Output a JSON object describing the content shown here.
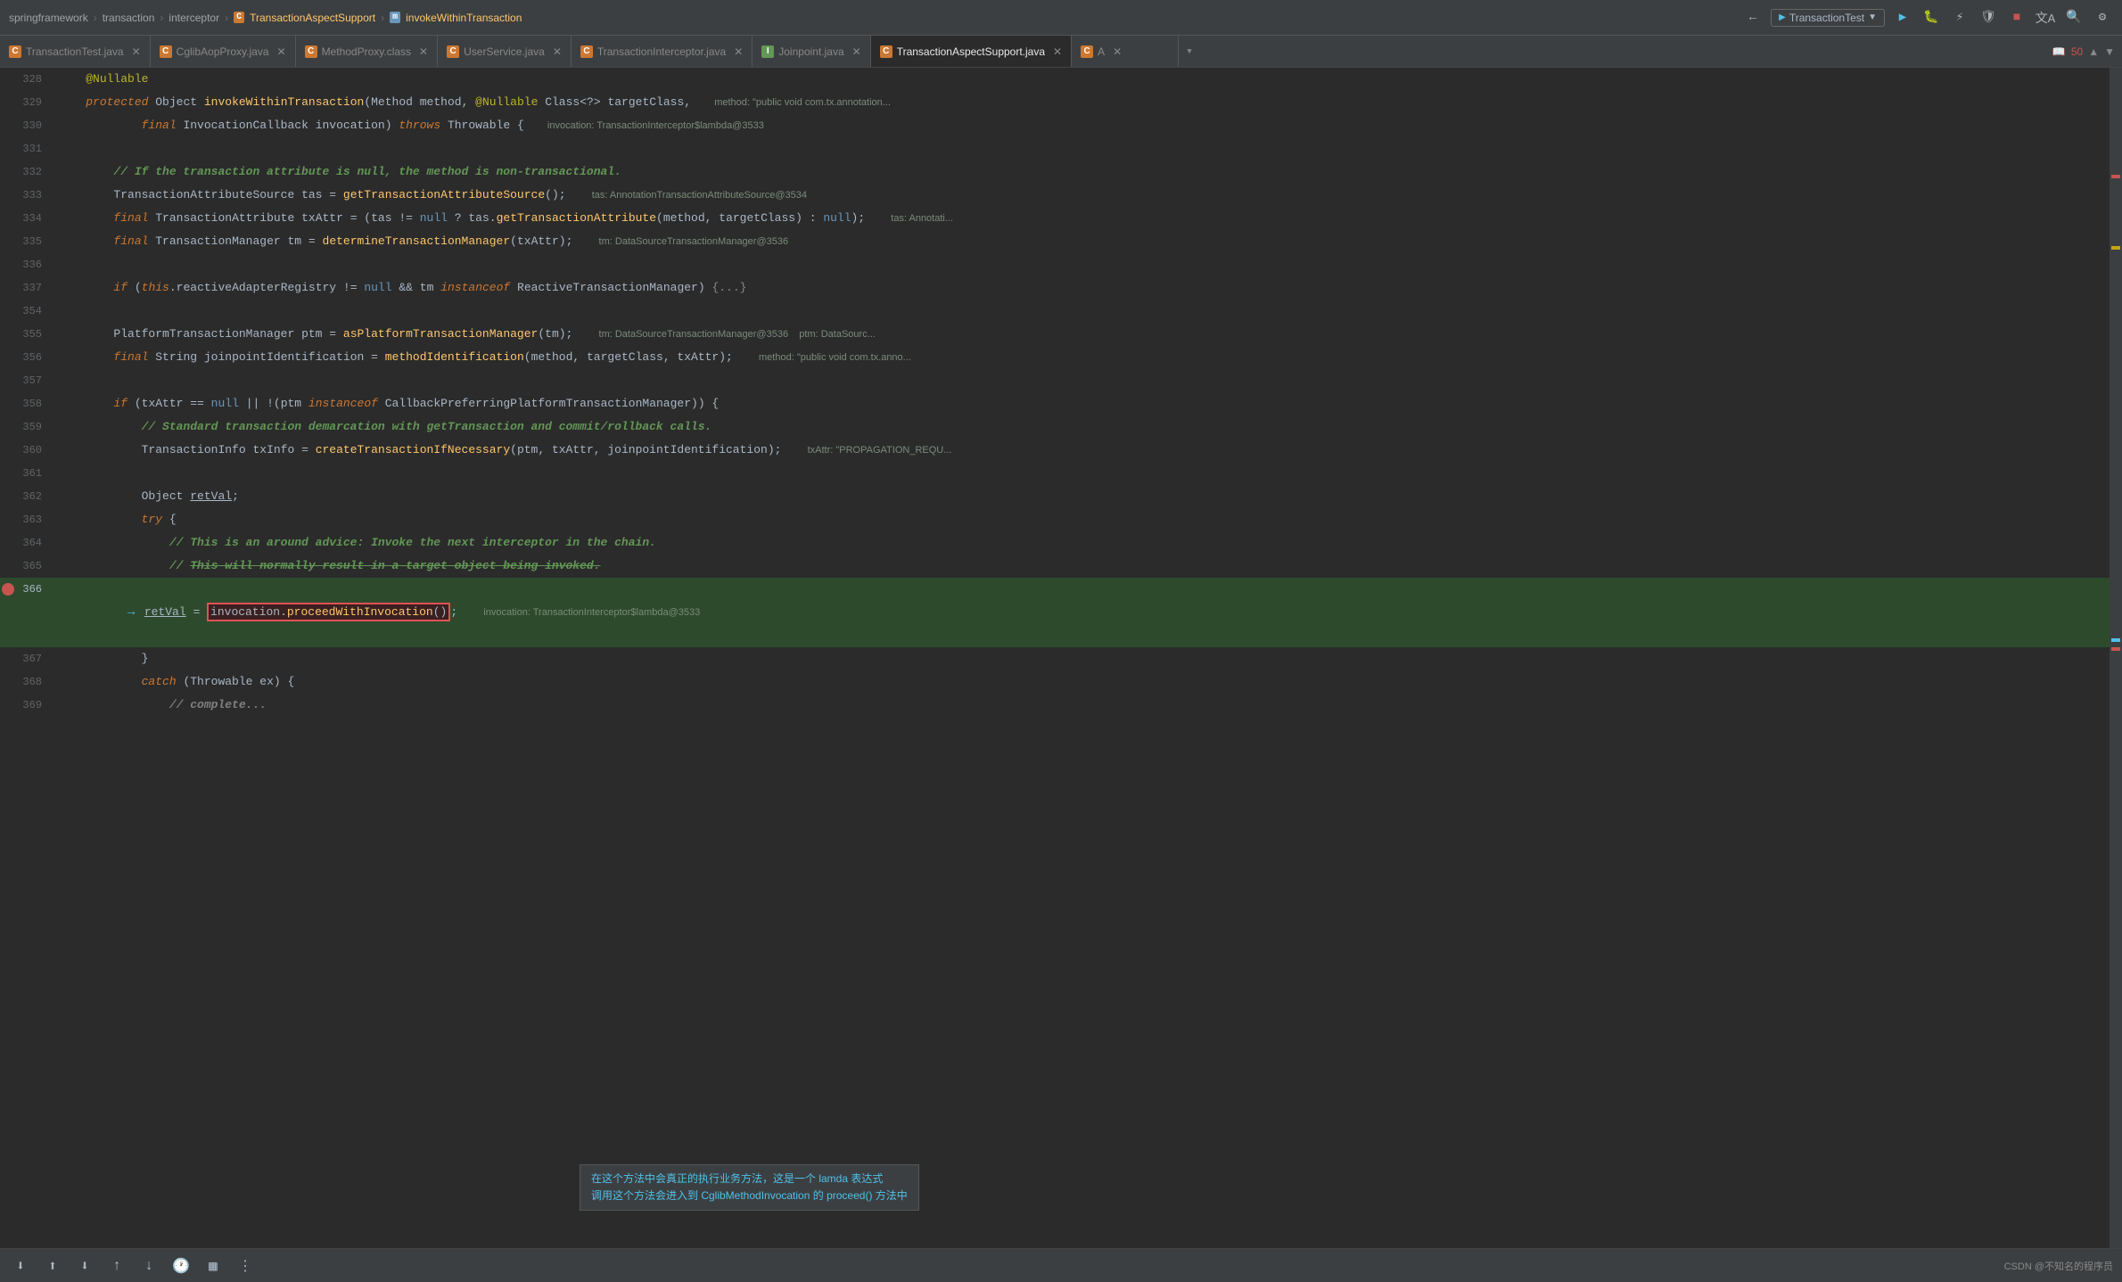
{
  "topbar": {
    "breadcrumbs": [
      {
        "label": "springframework",
        "type": "text"
      },
      {
        "label": "›",
        "type": "sep"
      },
      {
        "label": "transaction",
        "type": "text"
      },
      {
        "label": "›",
        "type": "sep"
      },
      {
        "label": "interceptor",
        "type": "text"
      },
      {
        "label": "›",
        "type": "sep"
      },
      {
        "label": "C TransactionAspectSupport",
        "type": "class"
      },
      {
        "label": "›",
        "type": "sep"
      },
      {
        "label": "m invokeWithinTransaction",
        "type": "method"
      }
    ],
    "run_config": "TransactionTest",
    "search_icon": "🔍",
    "settings_icon": "⚙"
  },
  "tabs": [
    {
      "label": "TransactionTest.java",
      "icon": "C",
      "type": "c",
      "active": false
    },
    {
      "label": "CglibAopProxy.java",
      "icon": "C",
      "type": "c",
      "active": false
    },
    {
      "label": "MethodProxy.class",
      "icon": "C",
      "type": "c",
      "active": false
    },
    {
      "label": "UserService.java",
      "icon": "C",
      "type": "c",
      "active": false
    },
    {
      "label": "TransactionInterceptor.java",
      "icon": "C",
      "type": "c",
      "active": false
    },
    {
      "label": "Joinpoint.java",
      "icon": "I",
      "type": "i",
      "active": false
    },
    {
      "label": "TransactionAspectSupport.java",
      "icon": "C",
      "type": "c",
      "active": true
    },
    {
      "label": "A",
      "icon": "C",
      "type": "c",
      "active": false
    }
  ],
  "lines": [
    {
      "num": 328,
      "content": "    @Nullable",
      "type": "annotation"
    },
    {
      "num": 329,
      "content": "    protected Object invokeWithinTransaction(Method method, @Nullable Class<?> targetClass,",
      "debug": "method: \"public void com.tx.annotation..."
    },
    {
      "num": 330,
      "content": "            final InvocationCallback invocation) throws Throwable {",
      "debug": "invocation: TransactionInterceptor$lambda@3533"
    },
    {
      "num": 331,
      "content": ""
    },
    {
      "num": 332,
      "content": "        // If the transaction attribute is null, the method is non-transactional.",
      "type": "comment-bold"
    },
    {
      "num": 333,
      "content": "        TransactionAttributeSource tas = getTransactionAttributeSource();",
      "debug": "tas: AnnotationTransactionAttributeSource@3534"
    },
    {
      "num": 334,
      "content": "        final TransactionAttribute txAttr = (tas != null ? tas.getTransactionAttribute(method, targetClass) : null);",
      "debug": "tas: Annotati..."
    },
    {
      "num": 335,
      "content": "        final TransactionManager tm = determineTransactionManager(txAttr);",
      "debug": "tm: DataSourceTransactionManager@3536"
    },
    {
      "num": 336,
      "content": ""
    },
    {
      "num": 337,
      "content": "        if (this.reactiveAdapterRegistry != null && tm instanceof ReactiveTransactionManager) {...}",
      "type": "collapsed"
    },
    {
      "num": 354,
      "content": ""
    },
    {
      "num": 355,
      "content": "        PlatformTransactionManager ptm = asPlatformTransactionManager(tm);",
      "debug": "tm: DataSourceTransactionManager@3536    ptm: DataSourc..."
    },
    {
      "num": 356,
      "content": "        final String joinpointIdentification = methodIdentification(method, targetClass, txAttr);",
      "debug": "method: \"public void com.tx.anno..."
    },
    {
      "num": 357,
      "content": ""
    },
    {
      "num": 358,
      "content": "        if (txAttr == null || !(ptm instanceof CallbackPreferringPlatformTransactionManager)) {"
    },
    {
      "num": 359,
      "content": "            // Standard transaction demarcation with getTransaction and commit/rollback calls.",
      "type": "comment-bold"
    },
    {
      "num": 360,
      "content": "            TransactionInfo txInfo = createTransactionIfNecessary(ptm, txAttr, joinpointIdentification);",
      "debug": "txAttr: \"PROPAGATION_REQU..."
    },
    {
      "num": 361,
      "content": ""
    },
    {
      "num": 362,
      "content": "            Object retVal;"
    },
    {
      "num": 363,
      "content": "            try {"
    },
    {
      "num": 364,
      "content": "                // This is an around advice: Invoke the next interceptor in the chain.",
      "type": "comment-bold"
    },
    {
      "num": 365,
      "content": "                // This will normally result in a target object being invoked.",
      "type": "comment-strikethrough"
    },
    {
      "num": 366,
      "content": "                retVal = invocation.proceedWithInvocation();",
      "highlight": true,
      "breakpoint": true,
      "debug": "invocation: TransactionInterceptor$lambda@3533"
    },
    {
      "num": 367,
      "content": "            }"
    },
    {
      "num": 368,
      "content": "            catch (Throwable ex) {"
    },
    {
      "num": 369,
      "content": "                // complete..."
    }
  ],
  "tooltip": {
    "line1": "在这个方法中会真正的执行业务方法，这是一个 lamda 表达式",
    "line2": "调用这个方法会进入到 CglibMethodInvocation 的 proceed() 方法中"
  },
  "bottom_bar": {
    "csdn_label": "CSDN @不知名的程序员"
  },
  "error_count": "50",
  "scroll_position": "50"
}
